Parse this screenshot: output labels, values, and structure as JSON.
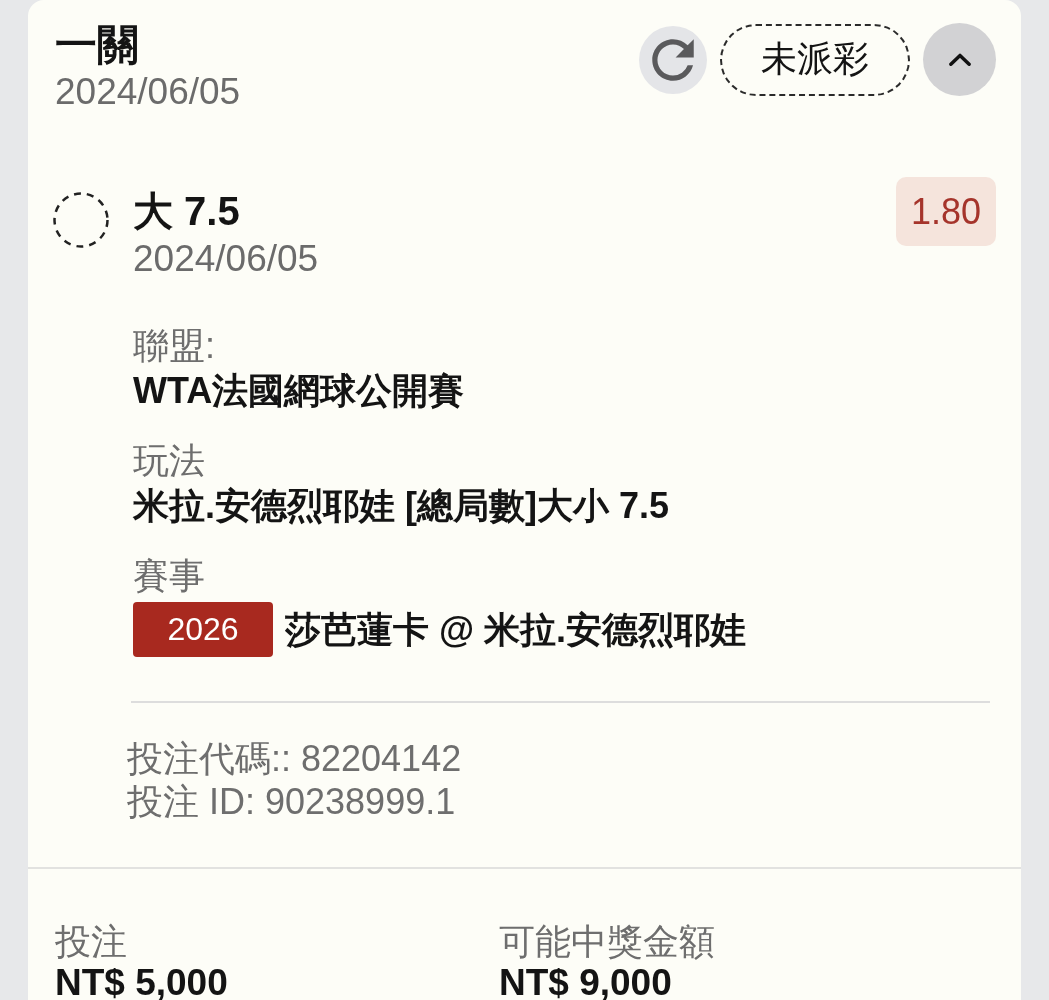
{
  "bet_card": {
    "header": {
      "title": "一關",
      "date": "2024/06/05",
      "status": "未派彩"
    },
    "expanded": true,
    "selection": {
      "name": "大 7.5",
      "date": "2024/06/05",
      "odds": "1.80"
    },
    "details": [
      {
        "label": "聯盟:",
        "value": "WTA法國網球公開賽"
      },
      {
        "label": "玩法",
        "value": "米拉.安德烈耶娃 [總局數]大小 7.5"
      },
      {
        "label": "賽事",
        "badge": "2026",
        "value": "莎芭蓮卡 @ 米拉.安德烈耶娃"
      }
    ],
    "bet_code": "投注代碼:: 82204142",
    "bet_id": "投注 ID: 90238999.1",
    "summary": [
      {
        "label": "投注",
        "value": "NT$ 5,000"
      },
      {
        "label": "可能中獎金額",
        "value": "NT$ 9,000"
      }
    ]
  }
}
